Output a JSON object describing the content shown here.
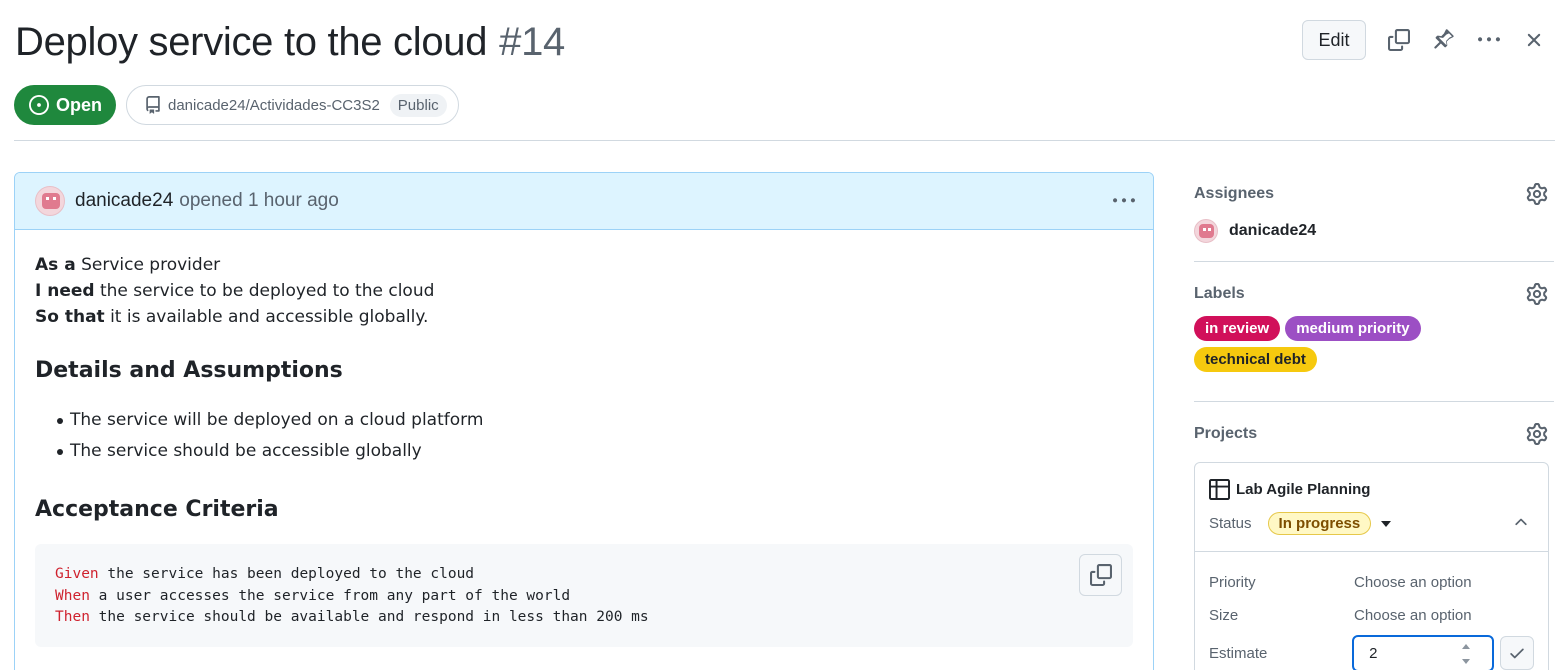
{
  "issue": {
    "title": "Deploy service to the cloud",
    "number": "#14",
    "state": "Open",
    "repo": "danicade24/Actividades-CC3S2",
    "visibility": "Public"
  },
  "toolbar": {
    "edit_label": "Edit"
  },
  "comment": {
    "author": "danicade24",
    "meta": "opened 1 hour ago",
    "story": [
      {
        "bold": "As a",
        "text": " Service provider"
      },
      {
        "bold": "I need",
        "text": " the service to be deployed to the cloud"
      },
      {
        "bold": "So that",
        "text": " it is available and accessible globally."
      }
    ],
    "details_heading": "Details and Assumptions",
    "details": [
      "The service will be deployed on a cloud platform",
      "The service should be accessible globally"
    ],
    "acceptance_heading": "Acceptance Criteria",
    "code": [
      {
        "kw": "Given",
        "text": " the service has been deployed to the cloud"
      },
      {
        "kw": "When",
        "text": " a user accesses the service from any part of the world"
      },
      {
        "kw": "Then",
        "text": " the service should be available and respond in less than 200 ms"
      }
    ]
  },
  "sidebar": {
    "assignees_heading": "Assignees",
    "assignee": "danicade24",
    "labels_heading": "Labels",
    "labels": [
      {
        "name": "in review",
        "bg": "#d1105a",
        "fg": "#ffffff"
      },
      {
        "name": "medium priority",
        "bg": "#9c4fc4",
        "fg": "#ffffff"
      },
      {
        "name": "technical debt",
        "bg": "#f6c90e",
        "fg": "#1f2328"
      }
    ],
    "projects_heading": "Projects",
    "project": {
      "name": "Lab Agile Planning",
      "status_label": "Status",
      "status_value": "In progress",
      "fields": [
        {
          "label": "Priority",
          "value": "Choose an option"
        },
        {
          "label": "Size",
          "value": "Choose an option"
        }
      ],
      "estimate_label": "Estimate",
      "estimate_value": "2"
    }
  },
  "colors": {
    "open_green": "#1f883d",
    "comment_header_bg": "#ddf4ff",
    "focus_blue": "#0969da",
    "keyword_red": "#cf222e"
  },
  "icons": [
    "issue-opened-icon",
    "repo-icon",
    "copy-icon",
    "pin-icon",
    "kebab-horizontal-icon",
    "close-icon",
    "gear-icon",
    "table-icon",
    "chevron-up-icon",
    "triangle-down-icon",
    "check-icon"
  ]
}
